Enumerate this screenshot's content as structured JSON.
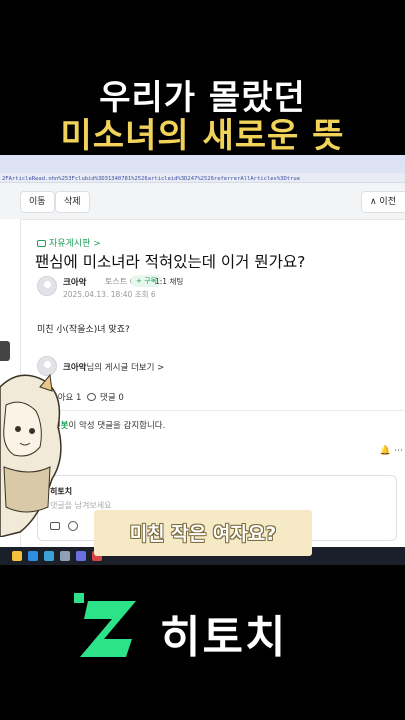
{
  "overlay": {
    "title_line1": "우리가 몰랐던",
    "title_line2": "미소녀의 새로운 뜻",
    "caption": "미친 작은 여자요?",
    "logo_text": "히토치",
    "title_color": "#f2d35a",
    "logo_color": "#2de38a"
  },
  "browser": {
    "url": "2FArticleRead.nhn%253Fclubid%3D31340781%2526articleid%3D247%2526referrerAllArticles%3Dtrue"
  },
  "cafe": {
    "move_button": "이동",
    "delete_button": "삭제",
    "prev_button": "∧ 이전",
    "board": "자유게시판 >",
    "title": "팬심에 미소녀라 적혀있는데 이거 뭔가요?",
    "author": "크아악",
    "rank": "토스트 ☺",
    "subscribe": "+ 구독",
    "chat": "1:1 채팅",
    "meta": "2025.04.13. 18:40   조회 6",
    "body": "미친 小(작을소)녀 맞죠?",
    "author_posts_name": "크아악",
    "author_posts_rest": "님의 게시글 더보기 >",
    "like": "좋아요 1",
    "comment": "댓글 0",
    "cleanbot_name": "클린봇",
    "cleanbot_rest": "이 악성 댓글을 감지합니다.",
    "bell": "🔔 ⋯",
    "comment_box_name": "히토치",
    "comment_placeholder": "댓글을 남겨보세요"
  }
}
